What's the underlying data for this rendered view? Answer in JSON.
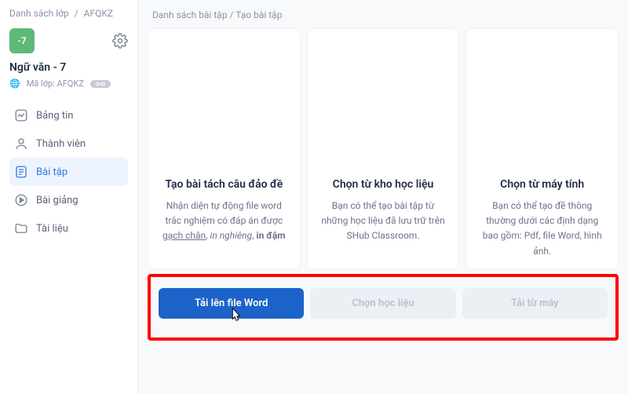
{
  "sidebar": {
    "crumb_root": "Danh sách lớp",
    "crumb_code": "AFQKZ",
    "class_badge": "-7",
    "class_title": "Ngữ văn - 7",
    "class_code_label": "Mã lớp: AFQKZ",
    "nav": [
      {
        "label": "Bảng tin"
      },
      {
        "label": "Thành viên"
      },
      {
        "label": "Bài tập"
      },
      {
        "label": "Bài giảng"
      },
      {
        "label": "Tài liệu"
      }
    ]
  },
  "main": {
    "crumb_root": "Danh sách bài tập",
    "crumb_current": "Tạo bài tập",
    "cards": [
      {
        "title": "Tạo bài tách câu đảo đề",
        "desc_pre": "Nhận diện tự động file word trắc nghiệm có đáp án được ",
        "desc_ul": "gạch chân",
        "desc_sep1": ", ",
        "desc_it": "in nghiêng",
        "desc_sep2": ", ",
        "desc_bd": "in đậm",
        "button": "Tải lên file Word"
      },
      {
        "title": "Chọn từ kho học liệu",
        "desc": "Bạn có thể tạo bài tập từ những học liệu đã lưu trữ trên SHub Classroom.",
        "button": "Chọn học liệu"
      },
      {
        "title": "Chọn từ máy tính",
        "desc": "Bạn có thể tạo đề thông thường dưới các định dạng bao gồm: Pdf, file Word, hình ảnh.",
        "button": "Tải từ máy"
      }
    ]
  }
}
